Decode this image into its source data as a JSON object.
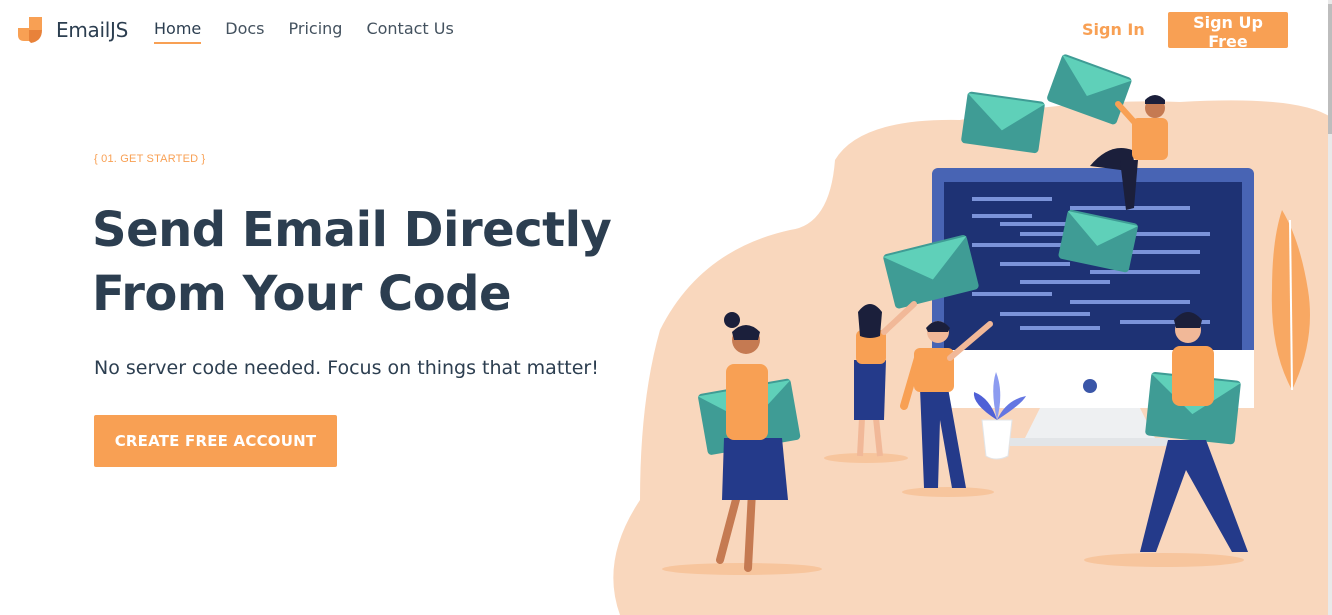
{
  "brand": {
    "name": "EmailJS",
    "logo_icon": "emailjs-logo-icon",
    "accent": "#f8a054",
    "text_color": "#2c3e50"
  },
  "nav": {
    "items": [
      {
        "label": "Home",
        "active": true
      },
      {
        "label": "Docs",
        "active": false
      },
      {
        "label": "Pricing",
        "active": false
      },
      {
        "label": "Contact Us",
        "active": false
      }
    ]
  },
  "auth": {
    "signin_label": "Sign In",
    "signup_label": "Sign Up Free"
  },
  "hero": {
    "eyebrow": "{ 01. GET STARTED }",
    "headline": "Send Email Directly From Your Code",
    "subtext": "No server code needed. Focus on things that matter!",
    "cta_label": "CREATE FREE ACCOUNT"
  },
  "illustration": {
    "icon": "people-sending-emails-illustration",
    "colors": {
      "blob": "#f9d7bd",
      "screen": "#1e3274",
      "envelope": "#3f9c95",
      "envelope_flap": "#5fd0b9",
      "shirt": "#f8a054",
      "pants": "#243a8a"
    }
  }
}
